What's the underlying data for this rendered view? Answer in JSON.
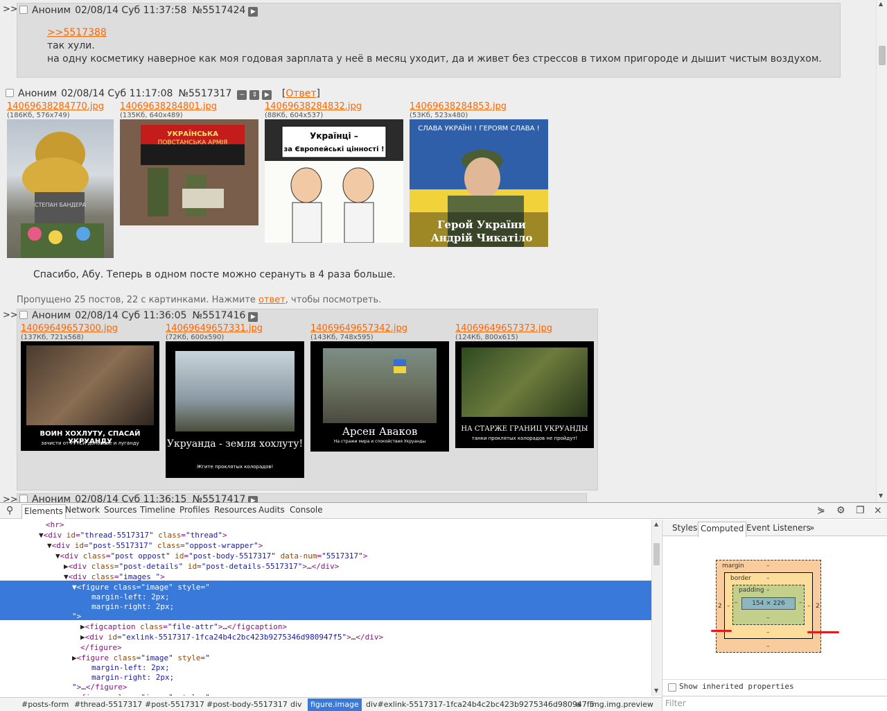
{
  "posts": [
    {
      "arrows": ">>",
      "name": "Аноним",
      "date": "02/08/14 Суб 11:37:58",
      "num": "№5517424",
      "quote": ">>5517388",
      "lines": [
        "так хули.",
        "на одну косметику наверное как моя годовая зарплата у неё в месяц уходит, да и живет без стрессов в тихом пригороде и дышит чистым воздухом."
      ]
    },
    {
      "name": "Аноним",
      "date": "02/08/14 Суб 11:17:08",
      "num": "№5517317",
      "reply_label": "Ответ",
      "files": [
        {
          "name": "14069638284770.jpg",
          "attr": "(186Кб, 576x749)"
        },
        {
          "name": "14069638284801.jpg",
          "attr": "(135Кб, 640x489)"
        },
        {
          "name": "14069638284832.jpg",
          "attr": "(88Кб, 604x537)"
        },
        {
          "name": "14069638284853.jpg",
          "attr": "(53Кб, 523x480)"
        }
      ],
      "image_texts": [
        "СТЕПАН БАНДЕРА",
        "УКРАЇНСЬКА ПОВСТАНСЬКА АРМІЯ",
        "Українці – за Європейські цінності !",
        "СЛАВА УКРАЇНІ ! ГЕРОЯМ СЛАВА !",
        "Герой України",
        "Андрій Чикатіло"
      ],
      "text": "Спасибо, Абу. Теперь в одном посте можно серануть в 4 раза больше.",
      "omitted_before": "Пропущено 25 постов, 22 с картинками. Нажмите ",
      "omitted_link": "ответ",
      "omitted_after": ", чтобы посмотреть."
    },
    {
      "arrows": ">>",
      "name": "Аноним",
      "date": "02/08/14 Суб 11:36:05",
      "num": "№5517416",
      "files": [
        {
          "name": "14069649657300.jpg",
          "attr": "(137Кб, 721x568)"
        },
        {
          "name": "14069649657331.jpg",
          "attr": "(72Кб, 600x590)"
        },
        {
          "name": "14069649657342.jpg",
          "attr": "(143Кб, 748x595)"
        },
        {
          "name": "14069649657373.jpg",
          "attr": "(124Кб, 800x615)"
        }
      ],
      "captions": [
        {
          "title": "ВОИН ХОХЛУТУ, СПАСАЙ УКРУАНДУ",
          "sub": "зачисти от РУТСИ донбабве и луганду"
        },
        {
          "title": "Укруанда - земля хохлуту!",
          "sub": "Жгите проклятых колорадов!"
        },
        {
          "title": "Арсен Аваков",
          "sub": "На стражи мира и спокойствия Укруанды"
        },
        {
          "title": "НА СТАРЖЕ ГРАНИЦ УКРУАНДЫ",
          "sub": "танки проклятых колорадов не пройдут!"
        }
      ]
    },
    {
      "arrows": ">>",
      "name": "Аноним",
      "date": "02/08/14 Суб 11:36:15",
      "num": "№5517417"
    }
  ],
  "devtools": {
    "tabs": [
      "Elements",
      "Network",
      "Sources",
      "Timeline",
      "Profiles",
      "Resources",
      "Audits",
      "Console"
    ],
    "side_tabs": [
      "Styles",
      "Computed",
      "Event Listeners"
    ],
    "side_more": "»",
    "box_model": {
      "margin": "margin",
      "border": "border",
      "padding": "padding",
      "content": "154 × 226",
      "dash": "–",
      "margin_left": "2",
      "margin_right": "2"
    },
    "show_inherited": "Show inherited properties",
    "filter_placeholder": "Filter",
    "breadcrumbs": [
      "#posts-form",
      "#thread-5517317",
      "#post-5517317",
      "#post-body-5517317",
      "div",
      "figure.image",
      "div#exlink-5517317-1fca24b4c2bc423b9275346d980947f5",
      "a",
      "img.img.preview"
    ]
  },
  "colors": {
    "link": "#ff6600",
    "post_bg": "#dddddd",
    "page_bg": "#eeeeee",
    "selection": "#3879d9",
    "tag": "#881280",
    "attr": "#994500",
    "value": "#1a1aa6"
  }
}
